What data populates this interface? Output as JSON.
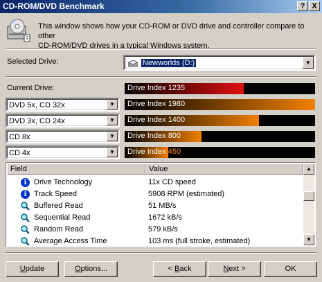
{
  "window": {
    "title": "CD-ROM/DVD Benchmark",
    "help_label": "?",
    "close_label": "X"
  },
  "intro": {
    "line1": "This window shows how your CD-ROM or DVD drive and controller compare to other",
    "line2": "CD-ROM/DVD drives in a typical Windows system."
  },
  "selected_drive": {
    "label": "Selected Drive:",
    "value": "Newworlds (D:)"
  },
  "current_drive": {
    "label": "Current Drive:",
    "index_text": "Drive Index 1235",
    "index_value": 1235
  },
  "comparisons": [
    {
      "combo": "DVD 5x, CD 32x",
      "index_text": "Drive Index 1980",
      "index_value": 1980
    },
    {
      "combo": "DVD 3x, CD 24x",
      "index_text": "Drive Index 1400",
      "index_value": 1400
    },
    {
      "combo": "CD 8x",
      "index_text": "Drive Index 800",
      "index_value": 800
    },
    {
      "combo": "CD 4x",
      "index_text": "Drive Index ",
      "index_suffix": "450",
      "index_value": 450
    }
  ],
  "bar_scale_max": 1980,
  "colors": {
    "current_bar": "#e01010",
    "compare_bar": "#f08000",
    "selection": "#0a246a",
    "title_start": "#0a246a",
    "title_end": "#a6caf0"
  },
  "table": {
    "columns": [
      "Field",
      "Value"
    ],
    "rows": [
      {
        "icon": "info-icon",
        "field": "Drive Technology",
        "value": "11x CD speed"
      },
      {
        "icon": "info-icon",
        "field": "Track Speed",
        "value": "5908 RPM (estimated)"
      },
      {
        "icon": "magnifier-icon",
        "field": "Buffered Read",
        "value": "51 MB/s"
      },
      {
        "icon": "magnifier-icon",
        "field": "Sequential Read",
        "value": "1672 kB/s"
      },
      {
        "icon": "magnifier-icon",
        "field": "Random Read",
        "value": "579 kB/s"
      },
      {
        "icon": "magnifier-icon",
        "field": "Average Access Time",
        "value": "103 ms (full stroke, estimated)"
      }
    ]
  },
  "buttons": {
    "update_u": "U",
    "update_rest": "pdate",
    "options_u": "O",
    "options_rest": "ptions...",
    "back_pre": "< ",
    "back_u": "B",
    "back_rest": "ack",
    "next_u": "N",
    "next_rest": "ext >",
    "ok": "OK"
  }
}
